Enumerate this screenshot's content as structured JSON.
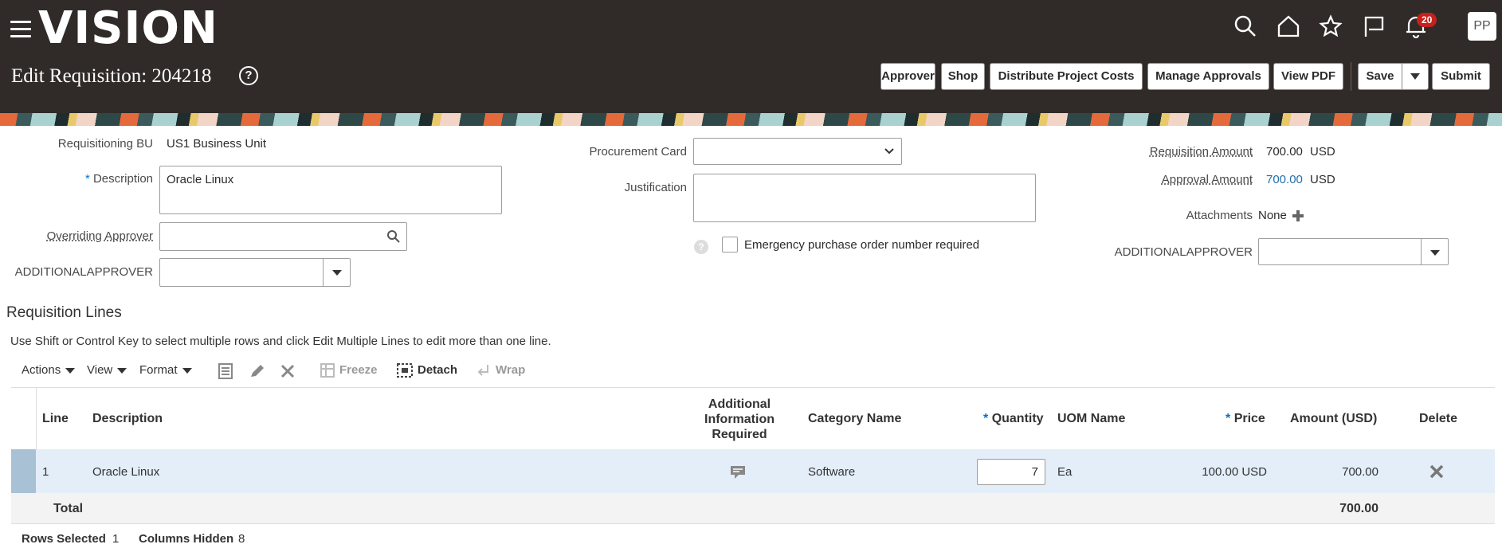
{
  "header": {
    "logo": "VISION",
    "page_title": "Edit Requisition: 204218",
    "help": "?",
    "notification_count": "20",
    "avatar_initials": "PP",
    "buttons": {
      "approver": "Approver",
      "shop": "Shop",
      "distribute": "Distribute Project Costs",
      "manage_approvals": "Manage Approvals",
      "view_pdf": "View PDF",
      "save": "Save",
      "submit": "Submit"
    }
  },
  "form": {
    "requisitioning_bu_label": "Requisitioning BU",
    "requisitioning_bu_value": "US1 Business Unit",
    "description_label": "Description",
    "description_value": "Oracle Linux",
    "overriding_approver_label": "Overriding Approver",
    "additional_approver_label": "ADDITIONALAPPROVER",
    "procurement_card_label": "Procurement Card",
    "justification_label": "Justification",
    "emergency_po_label": "Emergency purchase order number required",
    "requisition_amount_label": "Requisition Amount",
    "requisition_amount_value": "700.00",
    "requisition_amount_currency": "USD",
    "approval_amount_label": "Approval Amount",
    "approval_amount_value": "700.00",
    "approval_amount_currency": "USD",
    "attachments_label": "Attachments",
    "attachments_value": "None",
    "additional_approver_right_label": "ADDITIONALAPPROVER",
    "required_marker": "*"
  },
  "lines": {
    "section_title": "Requisition Lines",
    "instruction": "Use Shift or Control Key to select multiple rows and click Edit Multiple Lines to edit more than one line.",
    "toolbar": {
      "actions": "Actions",
      "view": "View",
      "format": "Format",
      "freeze": "Freeze",
      "detach": "Detach",
      "wrap": "Wrap"
    },
    "columns": {
      "line": "Line",
      "description": "Description",
      "additional_info_1": "Additional",
      "additional_info_2": "Information",
      "additional_info_3": "Required",
      "category_name": "Category Name",
      "quantity": "Quantity",
      "uom_name": "UOM Name",
      "price": "Price",
      "amount": "Amount (USD)",
      "delete": "Delete"
    },
    "rows": [
      {
        "line": "1",
        "description": "Oracle Linux",
        "category_name": "Software",
        "quantity": "7",
        "uom_name": "Ea",
        "price": "100.00 USD",
        "amount": "700.00"
      }
    ],
    "total_label": "Total",
    "total_value": "700.00",
    "footer": {
      "rows_selected_label": "Rows Selected",
      "rows_selected_value": "1",
      "columns_hidden_label": "Columns Hidden",
      "columns_hidden_value": "8"
    }
  },
  "colors": {
    "header_bg": "#302b28",
    "link_blue": "#0572ce",
    "selected_row": "#e3eef9",
    "badge_red": "#c7211d"
  }
}
